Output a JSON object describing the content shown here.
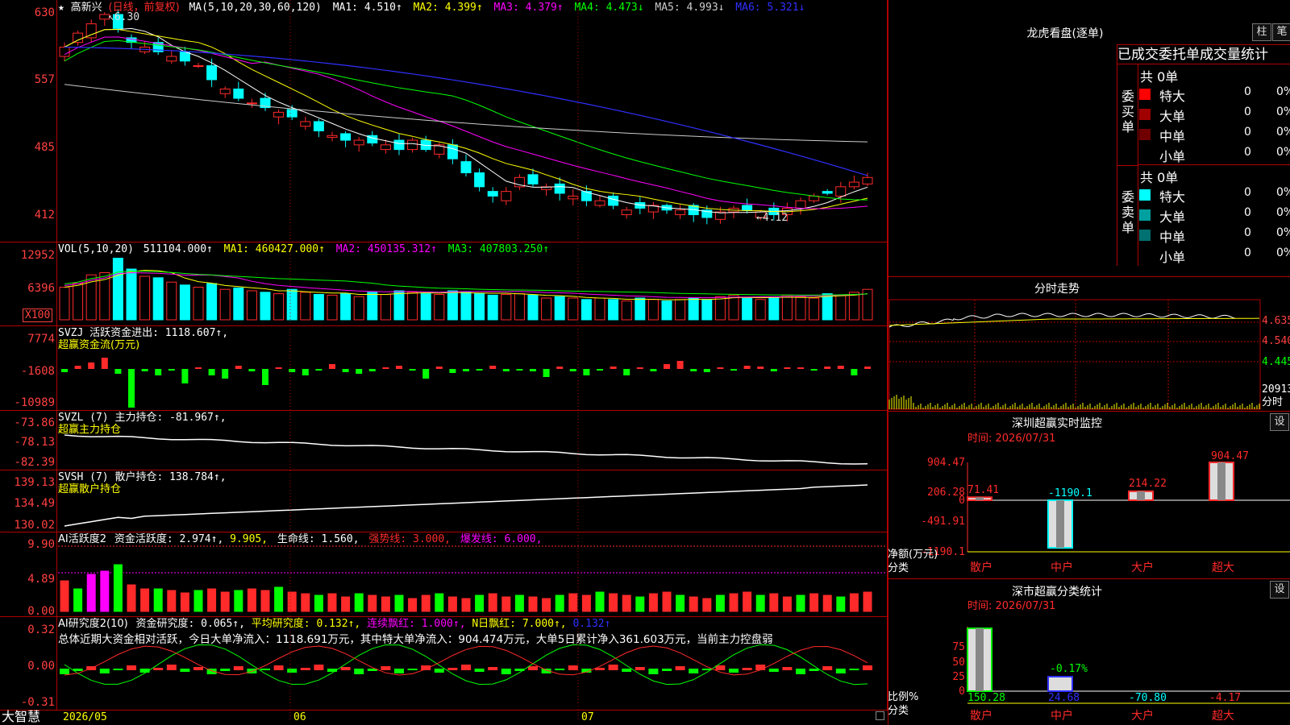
{
  "colors": {
    "up": "#ff2a2a",
    "down": "#00ffff",
    "grid": "#b00000",
    "bg": "#000000",
    "yellow": "#ffff00",
    "green": "#00ff00",
    "magenta": "#ff00ff",
    "blue": "#3030ff",
    "white": "#ffffff"
  },
  "main": {
    "title_star": "★",
    "title_name": "高新兴",
    "title_period": "(日线，前复权)",
    "ma_label": "MA(5,10,20,30,60,120)",
    "ma1": "MA1: 4.510↑",
    "ma2": "MA2: 4.399↑",
    "ma3": "MA3: 4.379↑",
    "ma4": "MA4: 4.473↓",
    "ma5": "MA5: 4.993↓",
    "ma6": "MA6: 5.321↓",
    "y_labels": [
      "630",
      "557",
      "485",
      "412"
    ],
    "high_mark": "6.30",
    "low_mark": "←4.12"
  },
  "vol": {
    "label": "VOL(5,10,20)",
    "value": "511104.000↑",
    "ma1": "MA1: 460427.000↑",
    "ma2": "MA2: 450135.312↑",
    "ma3": "MA3: 407803.250↑",
    "y_labels": [
      "12952",
      "6396"
    ],
    "unit": "X100"
  },
  "svzj": {
    "label": "SVZJ  活跃资金进出: 1118.607↑,",
    "sub": "超赢资金流(万元)",
    "y_labels": [
      "7774",
      "-1608",
      "-10989"
    ]
  },
  "svzl": {
    "label": "SVZL (7) 主力持仓: -81.967↑,",
    "sub": "超赢主力持仓",
    "y_labels": [
      "-73.86",
      "-78.13",
      "-82.39"
    ]
  },
  "svsh": {
    "label": "SVSH (7) 散户持仓: 138.784↑,",
    "sub": "超赢散户持仓",
    "y_labels": [
      "139.13",
      "134.49",
      "130.02"
    ]
  },
  "ai1": {
    "label": "AI活跃度2",
    "v1": "资金活跃度: 2.974↑,",
    "v2": "9.905,",
    "v3": "生命线: 1.560,",
    "v4": "强势线: 3.000,",
    "v5": "爆发线: 6.000,",
    "y_labels": [
      "9.90",
      "4.89",
      "0.00"
    ]
  },
  "ai2": {
    "label": "AI研究度2(10)",
    "v1": "资金研究度: 0.065↑,",
    "v2": "平均研究度: 0.132↑,",
    "v3": "连续飘红: 1.000↑,",
    "v4": "N日飘红: 7.000↑,",
    "v5": "0.132↑",
    "summary": "总体近期大资金相对活跃，今日大单净流入：1118.691万元，其中特大单净流入：904.474万元，大单5日累计净入361.603万元，当前主力控盘弱",
    "y_labels": [
      "0.32",
      "0.00",
      "-0.31"
    ]
  },
  "footer": {
    "brand": "大智慧",
    "dates": [
      "2026/05",
      "06",
      "07"
    ]
  },
  "lhb": {
    "title": "龙虎看盘(逐单)",
    "btn_bar": "柱",
    "btn_pen": "笔",
    "tabs": "已成交委托单成交量统计",
    "buy_side": "委买单",
    "sell_side": "委卖单",
    "buy_total": "共 0单",
    "sell_total": "共 0单",
    "buy_rows": [
      {
        "name": "特大",
        "n": "0",
        "p": "0%",
        "c": "#ff0000"
      },
      {
        "name": "大单",
        "n": "0",
        "p": "0%",
        "c": "#a00000"
      },
      {
        "name": "中单",
        "n": "0",
        "p": "0%",
        "c": "#700000"
      },
      {
        "name": "小单",
        "n": "0",
        "p": "0%",
        "c": "#000000"
      }
    ],
    "sell_rows": [
      {
        "name": "特大",
        "n": "0",
        "p": "0%",
        "c": "#00ffff"
      },
      {
        "name": "大单",
        "n": "0",
        "p": "0%",
        "c": "#00a0a0"
      },
      {
        "name": "中单",
        "n": "0",
        "p": "0%",
        "c": "#007070"
      },
      {
        "name": "小单",
        "n": "0",
        "p": "0%",
        "c": "#000000"
      }
    ]
  },
  "intraday": {
    "title": "分时走势",
    "prices": [
      "4.635",
      "4.540",
      "4.445"
    ],
    "vol": "20913",
    "label": "分时"
  },
  "szmon": {
    "title": "深圳超赢实时监控",
    "btn": "设",
    "time": "时间: 2026/07/31",
    "y_labels": [
      "904.47",
      "206.28",
      "0",
      "-491.91",
      "-1190.1"
    ],
    "net_label": "净额(万元)",
    "cat_label": "分类",
    "cats": [
      "散户",
      "中户",
      "大户",
      "超大"
    ],
    "values": [
      "71.41",
      "-1190.1",
      "214.22",
      "904.47"
    ],
    "values_num": [
      71.41,
      -1190.1,
      214.22,
      904.47
    ]
  },
  "szcls": {
    "title": "深市超赢分类统计",
    "btn": "设",
    "time": "时间: 2026/07/31",
    "y_labels": [
      "75",
      "50",
      "25",
      "0"
    ],
    "ratio_label": "比例%",
    "cat_label": "分类",
    "cats": [
      "散户",
      "中户",
      "大户",
      "超大"
    ],
    "values": [
      "150.28",
      "24.68",
      "-70.80",
      "-4.17"
    ],
    "mid_label": "-0.17%"
  }
}
